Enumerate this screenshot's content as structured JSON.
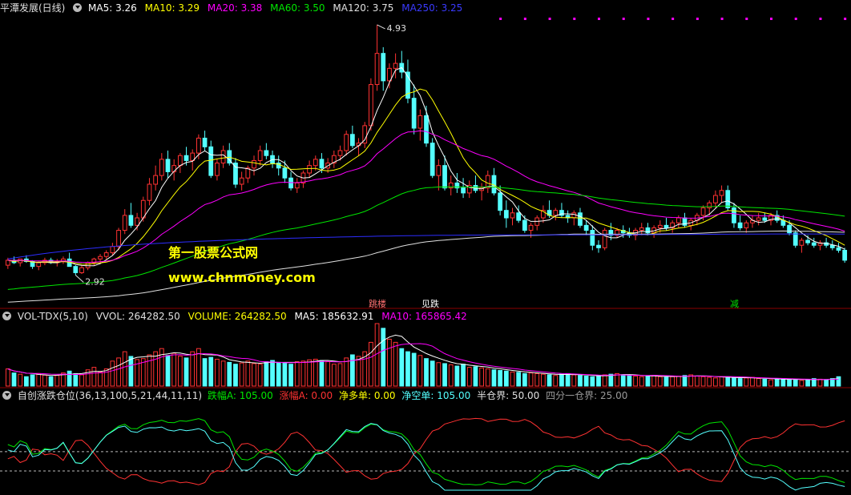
{
  "main_header": {
    "title": "平潭发展(日线)",
    "ma5": "MA5: 3.26",
    "ma10": "MA10: 3.29",
    "ma20": "MA20: 3.38",
    "ma60": "MA60: 3.50",
    "ma120": "MA120: 3.75",
    "ma250": "MA250: 3.25"
  },
  "vol_header": {
    "title": "VOL-TDX(5,10)",
    "vvol": "VVOL: 264282.50",
    "volume": "VOLUME: 264282.50",
    "ma5": "MA5: 185632.91",
    "ma10": "MA10: 165865.42"
  },
  "ind_header": {
    "title": "自创涨跌仓位(36,13,100,5,21,44,11,11)",
    "a": "跌幅A: 105.00",
    "b": "涨幅A: 0.00",
    "c": "净多单: 0.00",
    "d": "净空单: 105.00",
    "e": "半仓界: 50.00",
    "f": "四分一仓界: 25.00"
  },
  "watermark": {
    "line1": "第一股票公式网",
    "line2": "www.chnmoney.com"
  },
  "signals": {
    "s1": "跳楼",
    "s2": "见跌",
    "s3": "减"
  },
  "colors": {
    "up": "#ff3232",
    "down": "#54ffff",
    "ma5": "#ffffff",
    "ma10": "#ffff00",
    "ma20": "#ff00ff",
    "ma60": "#00e600",
    "ma120": "#e0e0e0",
    "ma250": "#2d2dff"
  },
  "chart_data": {
    "type": "candlestick",
    "title": "平潭发展(日线)",
    "ylim": [
      2.75,
      5.0
    ],
    "annotations": [
      {
        "label": "4.93",
        "value": 4.93,
        "kind": "high"
      },
      {
        "label": "2.92",
        "value": 2.92,
        "kind": "low"
      }
    ],
    "ohlc": [
      [
        3.0,
        3.06,
        2.97,
        3.04
      ],
      [
        3.04,
        3.07,
        3.01,
        3.02
      ],
      [
        3.02,
        3.05,
        2.99,
        3.05
      ],
      [
        3.05,
        3.08,
        3.02,
        3.03
      ],
      [
        3.03,
        3.04,
        2.97,
        2.99
      ],
      [
        2.99,
        3.03,
        2.96,
        3.02
      ],
      [
        3.02,
        3.06,
        3.0,
        3.04
      ],
      [
        3.04,
        3.06,
        3.01,
        3.02
      ],
      [
        3.02,
        3.05,
        2.99,
        3.03
      ],
      [
        3.03,
        3.07,
        3.01,
        3.05
      ],
      [
        3.05,
        3.1,
        3.02,
        2.99
      ],
      [
        2.99,
        3.0,
        2.92,
        2.94
      ],
      [
        2.94,
        3.0,
        2.93,
        2.98
      ],
      [
        2.98,
        3.03,
        2.96,
        3.02
      ],
      [
        3.02,
        3.06,
        3.0,
        3.05
      ],
      [
        3.05,
        3.09,
        3.02,
        3.07
      ],
      [
        3.07,
        3.12,
        3.05,
        3.1
      ],
      [
        3.1,
        3.18,
        3.08,
        3.15
      ],
      [
        3.15,
        3.3,
        3.12,
        3.28
      ],
      [
        3.28,
        3.45,
        3.25,
        3.4
      ],
      [
        3.4,
        3.5,
        3.3,
        3.32
      ],
      [
        3.32,
        3.42,
        3.28,
        3.38
      ],
      [
        3.38,
        3.55,
        3.35,
        3.52
      ],
      [
        3.52,
        3.7,
        3.48,
        3.65
      ],
      [
        3.65,
        3.8,
        3.6,
        3.72
      ],
      [
        3.72,
        3.9,
        3.68,
        3.85
      ],
      [
        3.85,
        3.92,
        3.7,
        3.75
      ],
      [
        3.75,
        3.85,
        3.68,
        3.8
      ],
      [
        3.8,
        3.9,
        3.74,
        3.88
      ],
      [
        3.88,
        3.95,
        3.8,
        3.84
      ],
      [
        3.84,
        3.93,
        3.76,
        3.9
      ],
      [
        3.9,
        4.05,
        3.85,
        4.02
      ],
      [
        4.02,
        4.08,
        3.92,
        3.95
      ],
      [
        3.95,
        4.0,
        3.7,
        3.72
      ],
      [
        3.72,
        3.85,
        3.68,
        3.82
      ],
      [
        3.82,
        3.96,
        3.78,
        3.92
      ],
      [
        3.92,
        3.98,
        3.8,
        3.82
      ],
      [
        3.82,
        3.86,
        3.62,
        3.65
      ],
      [
        3.65,
        3.75,
        3.6,
        3.7
      ],
      [
        3.7,
        3.8,
        3.66,
        3.78
      ],
      [
        3.78,
        3.88,
        3.72,
        3.84
      ],
      [
        3.84,
        3.96,
        3.8,
        3.92
      ],
      [
        3.92,
        3.98,
        3.85,
        3.88
      ],
      [
        3.88,
        3.92,
        3.78,
        3.82
      ],
      [
        3.82,
        3.88,
        3.72,
        3.78
      ],
      [
        3.78,
        3.84,
        3.66,
        3.7
      ],
      [
        3.7,
        3.75,
        3.6,
        3.62
      ],
      [
        3.62,
        3.7,
        3.58,
        3.66
      ],
      [
        3.66,
        3.76,
        3.62,
        3.74
      ],
      [
        3.74,
        3.84,
        3.7,
        3.8
      ],
      [
        3.8,
        3.88,
        3.76,
        3.85
      ],
      [
        3.85,
        3.9,
        3.74,
        3.78
      ],
      [
        3.78,
        3.86,
        3.74,
        3.82
      ],
      [
        3.82,
        3.92,
        3.78,
        3.88
      ],
      [
        3.88,
        3.96,
        3.84,
        3.92
      ],
      [
        3.92,
        4.08,
        3.88,
        4.05
      ],
      [
        4.05,
        4.12,
        3.94,
        3.96
      ],
      [
        3.96,
        4.02,
        3.88,
        3.98
      ],
      [
        3.98,
        4.15,
        3.94,
        4.12
      ],
      [
        4.12,
        4.5,
        4.08,
        4.45
      ],
      [
        4.45,
        4.93,
        4.4,
        4.7
      ],
      [
        4.7,
        4.75,
        4.4,
        4.48
      ],
      [
        4.48,
        4.62,
        4.42,
        4.58
      ],
      [
        4.58,
        4.7,
        4.5,
        4.62
      ],
      [
        4.62,
        4.72,
        4.5,
        4.55
      ],
      [
        4.55,
        4.65,
        4.3,
        4.34
      ],
      [
        4.34,
        4.45,
        4.05,
        4.1
      ],
      [
        4.1,
        4.25,
        4.0,
        4.2
      ],
      [
        4.2,
        4.28,
        3.95,
        3.98
      ],
      [
        3.98,
        4.02,
        3.7,
        3.72
      ],
      [
        3.72,
        3.85,
        3.6,
        3.8
      ],
      [
        3.8,
        3.88,
        3.6,
        3.62
      ],
      [
        3.62,
        3.72,
        3.56,
        3.66
      ],
      [
        3.66,
        3.74,
        3.58,
        3.62
      ],
      [
        3.62,
        3.7,
        3.54,
        3.58
      ],
      [
        3.58,
        3.68,
        3.54,
        3.64
      ],
      [
        3.64,
        3.72,
        3.58,
        3.6
      ],
      [
        3.6,
        3.66,
        3.52,
        3.62
      ],
      [
        3.62,
        3.76,
        3.58,
        3.72
      ],
      [
        3.72,
        3.78,
        3.56,
        3.58
      ],
      [
        3.58,
        3.64,
        3.4,
        3.44
      ],
      [
        3.44,
        3.52,
        3.3,
        3.38
      ],
      [
        3.38,
        3.46,
        3.32,
        3.42
      ],
      [
        3.42,
        3.48,
        3.34,
        3.36
      ],
      [
        3.36,
        3.4,
        3.26,
        3.28
      ],
      [
        3.28,
        3.34,
        3.22,
        3.32
      ],
      [
        3.32,
        3.4,
        3.28,
        3.38
      ],
      [
        3.38,
        3.48,
        3.34,
        3.44
      ],
      [
        3.44,
        3.52,
        3.38,
        3.4
      ],
      [
        3.4,
        3.46,
        3.36,
        3.44
      ],
      [
        3.44,
        3.5,
        3.38,
        3.4
      ],
      [
        3.4,
        3.44,
        3.34,
        3.38
      ],
      [
        3.38,
        3.44,
        3.32,
        3.42
      ],
      [
        3.42,
        3.46,
        3.3,
        3.32
      ],
      [
        3.32,
        3.36,
        3.24,
        3.28
      ],
      [
        3.28,
        3.32,
        3.12,
        3.16
      ],
      [
        3.16,
        3.2,
        3.1,
        3.14
      ],
      [
        3.14,
        3.3,
        3.12,
        3.28
      ],
      [
        3.28,
        3.34,
        3.2,
        3.24
      ],
      [
        3.24,
        3.3,
        3.22,
        3.28
      ],
      [
        3.28,
        3.32,
        3.22,
        3.26
      ],
      [
        3.26,
        3.3,
        3.22,
        3.24
      ],
      [
        3.24,
        3.3,
        3.2,
        3.28
      ],
      [
        3.28,
        3.34,
        3.24,
        3.3
      ],
      [
        3.3,
        3.34,
        3.24,
        3.26
      ],
      [
        3.26,
        3.32,
        3.22,
        3.3
      ],
      [
        3.3,
        3.36,
        3.26,
        3.32
      ],
      [
        3.32,
        3.38,
        3.28,
        3.3
      ],
      [
        3.3,
        3.36,
        3.26,
        3.34
      ],
      [
        3.34,
        3.4,
        3.3,
        3.38
      ],
      [
        3.38,
        3.42,
        3.3,
        3.32
      ],
      [
        3.32,
        3.38,
        3.28,
        3.36
      ],
      [
        3.36,
        3.42,
        3.32,
        3.4
      ],
      [
        3.4,
        3.48,
        3.36,
        3.46
      ],
      [
        3.46,
        3.52,
        3.4,
        3.5
      ],
      [
        3.5,
        3.6,
        3.46,
        3.56
      ],
      [
        3.56,
        3.64,
        3.5,
        3.6
      ],
      [
        3.6,
        3.64,
        3.44,
        3.46
      ],
      [
        3.46,
        3.5,
        3.3,
        3.34
      ],
      [
        3.34,
        3.4,
        3.28,
        3.3
      ],
      [
        3.3,
        3.36,
        3.26,
        3.34
      ],
      [
        3.34,
        3.4,
        3.3,
        3.36
      ],
      [
        3.36,
        3.42,
        3.32,
        3.38
      ],
      [
        3.38,
        3.42,
        3.34,
        3.36
      ],
      [
        3.36,
        3.42,
        3.32,
        3.4
      ],
      [
        3.4,
        3.44,
        3.34,
        3.36
      ],
      [
        3.36,
        3.4,
        3.3,
        3.32
      ],
      [
        3.32,
        3.36,
        3.24,
        3.26
      ],
      [
        3.26,
        3.28,
        3.14,
        3.16
      ],
      [
        3.16,
        3.22,
        3.1,
        3.2
      ],
      [
        3.2,
        3.24,
        3.16,
        3.18
      ],
      [
        3.18,
        3.22,
        3.14,
        3.16
      ],
      [
        3.16,
        3.2,
        3.12,
        3.18
      ],
      [
        3.18,
        3.22,
        3.14,
        3.16
      ],
      [
        3.16,
        3.2,
        3.12,
        3.14
      ],
      [
        3.14,
        3.18,
        3.1,
        3.12
      ],
      [
        3.12,
        3.14,
        3.02,
        3.04
      ]
    ],
    "volume": [
      55,
      42,
      38,
      30,
      36,
      40,
      35,
      30,
      34,
      42,
      48,
      40,
      36,
      52,
      60,
      45,
      55,
      80,
      90,
      110,
      95,
      85,
      88,
      100,
      110,
      120,
      98,
      105,
      96,
      90,
      110,
      120,
      88,
      92,
      86,
      80,
      76,
      70,
      74,
      80,
      72,
      70,
      78,
      82,
      76,
      74,
      70,
      78,
      80,
      84,
      86,
      82,
      78,
      70,
      72,
      90,
      100,
      95,
      110,
      140,
      200,
      185,
      150,
      140,
      120,
      110,
      105,
      98,
      88,
      80,
      75,
      72,
      68,
      64,
      70,
      60,
      62,
      58,
      55,
      52,
      50,
      48,
      45,
      44,
      40,
      42,
      40,
      38,
      36,
      34,
      38,
      40,
      36,
      34,
      32,
      30,
      34,
      36,
      38,
      40,
      36,
      34,
      32,
      30,
      32,
      34,
      30,
      28,
      30,
      32,
      34,
      36,
      32,
      30,
      28,
      26,
      30,
      28,
      26,
      24,
      26,
      28,
      24,
      22,
      20,
      22,
      24,
      20,
      22,
      18,
      20,
      24,
      22,
      20,
      24,
      30
    ]
  }
}
